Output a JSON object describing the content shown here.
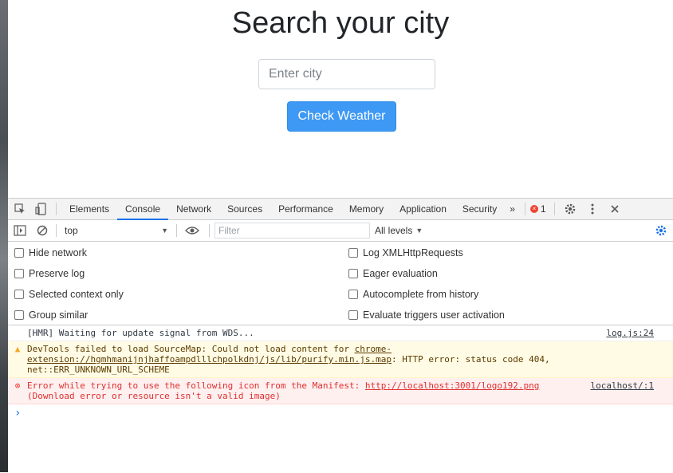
{
  "app": {
    "title": "Search your city",
    "input_placeholder": "Enter city",
    "button_label": "Check Weather"
  },
  "devtools": {
    "tabs": [
      "Elements",
      "Console",
      "Network",
      "Sources",
      "Performance",
      "Memory",
      "Application",
      "Security"
    ],
    "active_tab": "Console",
    "more_tabs_label": "»",
    "error_count": "1",
    "context_select": "top",
    "filter_placeholder": "Filter",
    "levels_label": "All levels",
    "settings_left": [
      "Hide network",
      "Preserve log",
      "Selected context only",
      "Group similar"
    ],
    "settings_right": [
      "Log XMLHttpRequests",
      "Eager evaluation",
      "Autocomplete from history",
      "Evaluate triggers user activation"
    ],
    "messages": [
      {
        "level": "log",
        "text": "[HMR] Waiting for update signal from WDS...",
        "source": "log.js:24"
      },
      {
        "level": "warning",
        "prefix": "DevTools failed to load SourceMap: Could not load content for ",
        "link": "chrome-extension://hgmhmanijnjhaffoampdlllchpolkdnj/js/lib/purify.min.js.map",
        "suffix": ": HTTP error: status code 404, net::ERR_UNKNOWN_URL_SCHEME"
      },
      {
        "level": "error",
        "prefix": "Error while trying to use the following icon from the Manifest: ",
        "link": "http://localhost:3001/logo192.png",
        "suffix": "(Download error or resource isn't a valid image)",
        "source": "localhost/:1"
      }
    ],
    "prompt_symbol": "›"
  },
  "colors": {
    "button_bg": "#3e99f4",
    "active_tab_underline": "#1a73e8",
    "warning_bg": "#fffbe5",
    "error_bg": "#fff0f0",
    "error_text": "#e02e2e"
  }
}
